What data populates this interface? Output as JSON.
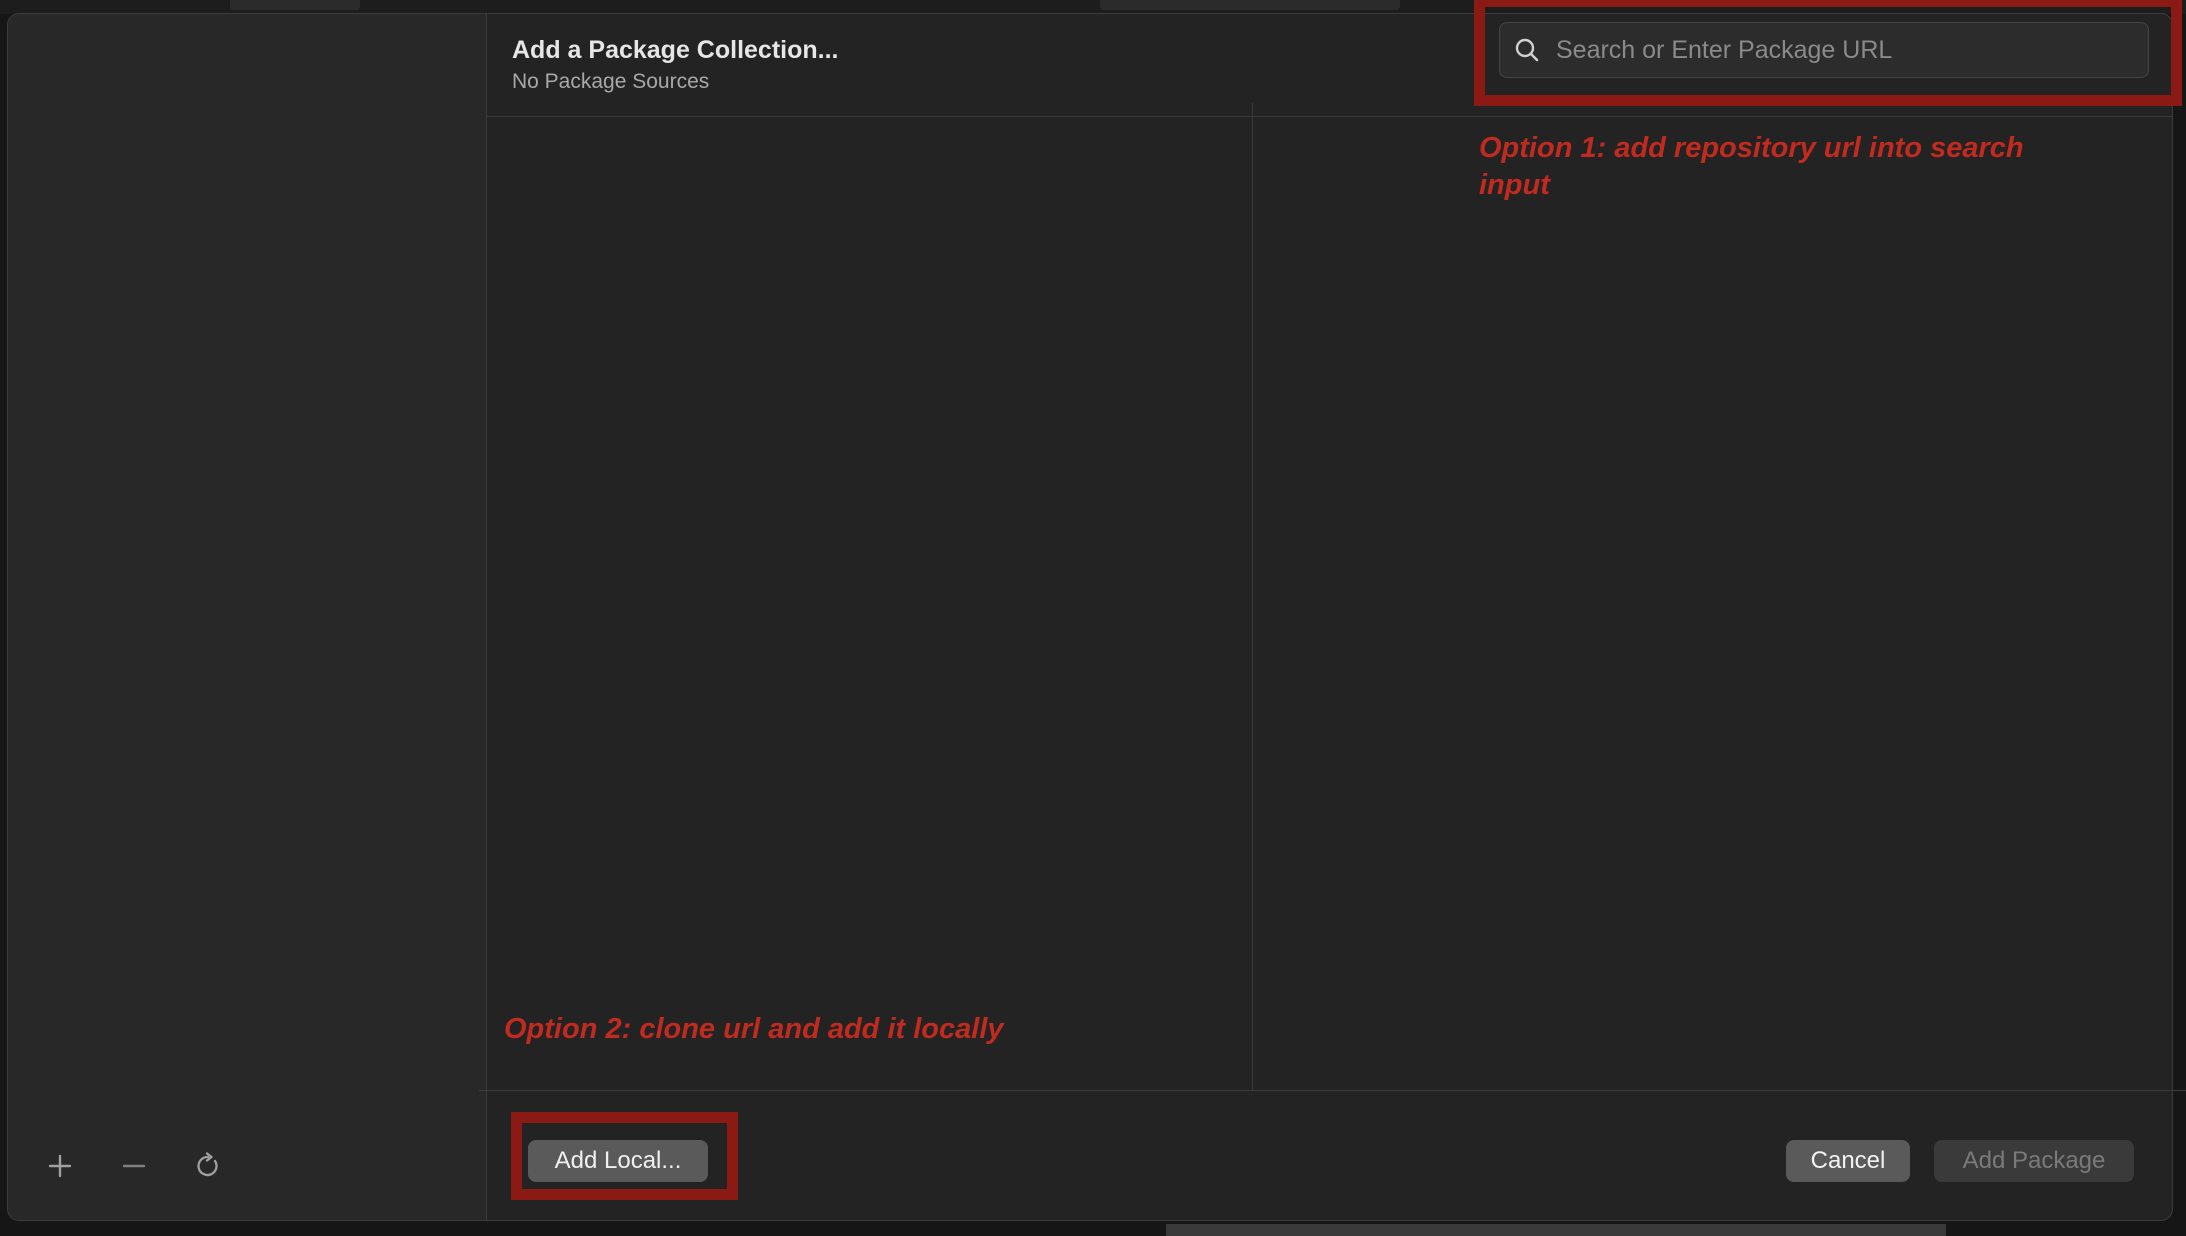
{
  "header": {
    "title": "Add a Package Collection...",
    "subtitle": "No Package Sources"
  },
  "search": {
    "placeholder": "Search or Enter Package URL",
    "value": ""
  },
  "annotations": {
    "option1": "Option 1: add repository url into search input",
    "option2": "Option 2: clone url and add it locally",
    "color": "#8c1a14"
  },
  "sidebar": {
    "tools": [
      {
        "icon": "plus-icon"
      },
      {
        "icon": "minus-icon"
      },
      {
        "icon": "refresh-icon"
      }
    ]
  },
  "footer": {
    "add_local_label": "Add Local...",
    "cancel_label": "Cancel",
    "add_package_label": "Add Package",
    "add_package_enabled": false
  }
}
